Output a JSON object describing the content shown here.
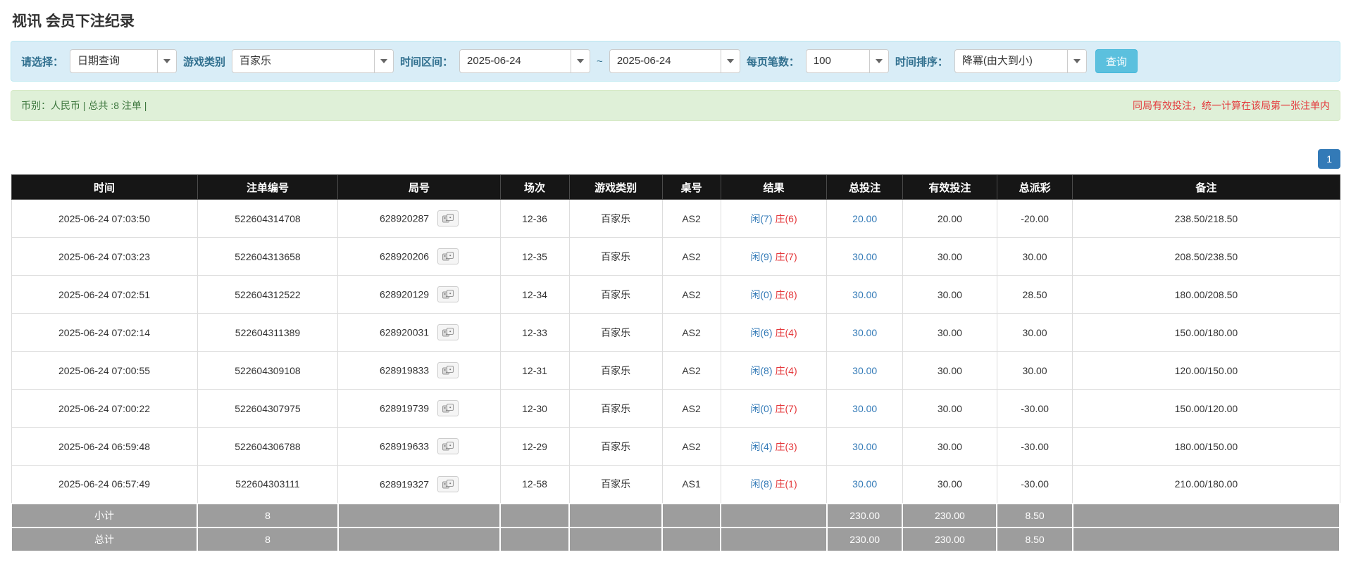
{
  "page": {
    "title": "视讯 会员下注纪录"
  },
  "colors": {
    "accent_blue": "#337ab7",
    "filter_bar_bg": "#d9edf7",
    "summary_bar_bg": "#dff0d8",
    "summary_text_green": "#3c763d",
    "danger_red": "#e4393c",
    "table_header_bg": "#161616",
    "table_footer_bg": "#9d9d9d",
    "query_button_bg": "#5bc0de"
  },
  "filters": {
    "select_label": "请选择：",
    "select_value": "日期查询",
    "game_type_label": "游戏类别",
    "game_type_value": "百家乐",
    "time_range_label": "时间区间：",
    "date_from": "2025-06-24",
    "range_separator": "~",
    "date_to": "2025-06-24",
    "page_size_label": "每页笔数：",
    "page_size_value": "100",
    "sort_label": "时间排序：",
    "sort_value": "降冪(由大到小)",
    "search_button_label": "查询"
  },
  "summary": {
    "left_text": "币别：人民币 | 总共 :8 注单 |",
    "right_note": "同局有效投注，统一计算在该局第一张注单内"
  },
  "pagination": {
    "current_page": "1"
  },
  "table": {
    "headers": [
      "时间",
      "注单编号",
      "局号",
      "场次",
      "游戏类别",
      "桌号",
      "结果",
      "总投注",
      "有效投注",
      "总派彩",
      "备注"
    ],
    "rows": [
      {
        "time": "2025-06-24 07:03:50",
        "bet_id": "522604314708",
        "round_id": "628920287",
        "session": "12-36",
        "game": "百家乐",
        "table_no": "AS2",
        "result_player": "闲(7)",
        "result_banker": "庄(6)",
        "total_bet": "20.00",
        "valid_bet": "20.00",
        "payout": "-20.00",
        "note": "238.50/218.50"
      },
      {
        "time": "2025-06-24 07:03:23",
        "bet_id": "522604313658",
        "round_id": "628920206",
        "session": "12-35",
        "game": "百家乐",
        "table_no": "AS2",
        "result_player": "闲(9)",
        "result_banker": "庄(7)",
        "total_bet": "30.00",
        "valid_bet": "30.00",
        "payout": "30.00",
        "note": "208.50/238.50"
      },
      {
        "time": "2025-06-24 07:02:51",
        "bet_id": "522604312522",
        "round_id": "628920129",
        "session": "12-34",
        "game": "百家乐",
        "table_no": "AS2",
        "result_player": "闲(0)",
        "result_banker": "庄(8)",
        "total_bet": "30.00",
        "valid_bet": "30.00",
        "payout": "28.50",
        "note": "180.00/208.50"
      },
      {
        "time": "2025-06-24 07:02:14",
        "bet_id": "522604311389",
        "round_id": "628920031",
        "session": "12-33",
        "game": "百家乐",
        "table_no": "AS2",
        "result_player": "闲(6)",
        "result_banker": "庄(4)",
        "total_bet": "30.00",
        "valid_bet": "30.00",
        "payout": "30.00",
        "note": "150.00/180.00"
      },
      {
        "time": "2025-06-24 07:00:55",
        "bet_id": "522604309108",
        "round_id": "628919833",
        "session": "12-31",
        "game": "百家乐",
        "table_no": "AS2",
        "result_player": "闲(8)",
        "result_banker": "庄(4)",
        "total_bet": "30.00",
        "valid_bet": "30.00",
        "payout": "30.00",
        "note": "120.00/150.00"
      },
      {
        "time": "2025-06-24 07:00:22",
        "bet_id": "522604307975",
        "round_id": "628919739",
        "session": "12-30",
        "game": "百家乐",
        "table_no": "AS2",
        "result_player": "闲(0)",
        "result_banker": "庄(7)",
        "total_bet": "30.00",
        "valid_bet": "30.00",
        "payout": "-30.00",
        "note": "150.00/120.00"
      },
      {
        "time": "2025-06-24 06:59:48",
        "bet_id": "522604306788",
        "round_id": "628919633",
        "session": "12-29",
        "game": "百家乐",
        "table_no": "AS2",
        "result_player": "闲(4)",
        "result_banker": "庄(3)",
        "total_bet": "30.00",
        "valid_bet": "30.00",
        "payout": "-30.00",
        "note": "180.00/150.00"
      },
      {
        "time": "2025-06-24 06:57:49",
        "bet_id": "522604303111",
        "round_id": "628919327",
        "session": "12-58",
        "game": "百家乐",
        "table_no": "AS1",
        "result_player": "闲(8)",
        "result_banker": "庄(1)",
        "total_bet": "30.00",
        "valid_bet": "30.00",
        "payout": "-30.00",
        "note": "210.00/180.00"
      }
    ],
    "subtotal": {
      "label": "小计",
      "count": "8",
      "total_bet": "230.00",
      "valid_bet": "230.00",
      "payout": "8.50"
    },
    "total": {
      "label": "总计",
      "count": "8",
      "total_bet": "230.00",
      "valid_bet": "230.00",
      "payout": "8.50"
    }
  }
}
